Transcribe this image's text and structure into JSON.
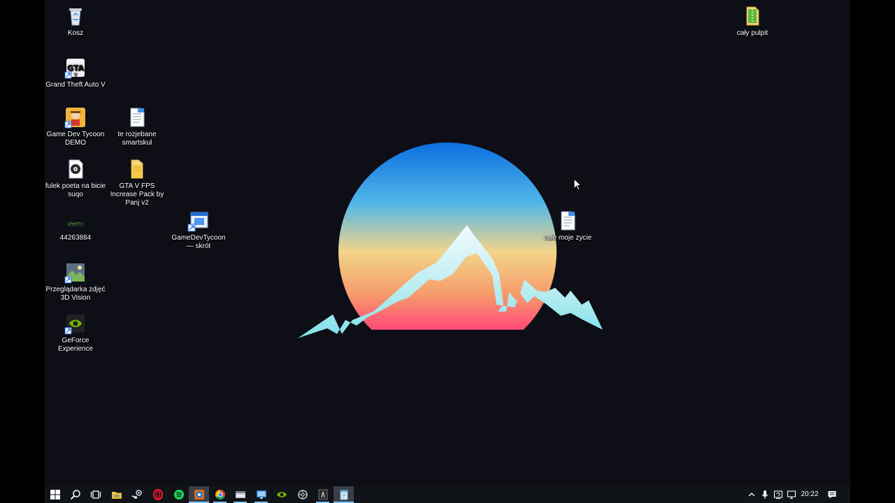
{
  "colors": {
    "desktop_background": "#0d0e16",
    "taskbar": "#101317",
    "sun_top": "#1a7ee6",
    "sun_bottom": "#ff1f7a",
    "mountain": "#c9f1f5"
  },
  "desktop_icons": [
    {
      "label": "Kosz",
      "icon": "recycle-bin-icon"
    },
    {
      "label": "Grand Theft Auto V",
      "icon": "gta-v-icon"
    },
    {
      "label": "Game Dev Tycoon DEMO",
      "icon": "game-dev-tycoon-icon"
    },
    {
      "label": "te rozjebane smartskul",
      "icon": "text-document-icon"
    },
    {
      "label": "fulek poeta na bicie suqo",
      "icon": "media-file-icon"
    },
    {
      "label": "GTA V FPS Increase Pack by Panj v2",
      "icon": "folder-icon"
    },
    {
      "label": "44263884",
      "icon": "image-file-icon"
    },
    {
      "label": "GameDevTycoon — skrót",
      "icon": "shortcut-icon"
    },
    {
      "label": "Przeglądarka zdjęć 3D Vision",
      "icon": "3d-vision-icon"
    },
    {
      "label": "GeForce Experience",
      "icon": "geforce-icon"
    },
    {
      "label": "całe moje zycie",
      "icon": "text-document-icon"
    },
    {
      "label": "cały pulpit",
      "icon": "archive-icon"
    }
  ],
  "taskbar": {
    "start": "windows-start-icon",
    "search": "search-icon",
    "task_view": "task-view-icon",
    "pinned": [
      "file-explorer-icon",
      "steam-icon",
      "opera-icon",
      "spotify-icon",
      "blue-app-icon",
      "chrome-icon",
      "app-window-icon",
      "monitor-app-icon",
      "nvidia-icon",
      "gear-app-icon",
      "dark-app-icon",
      "notepad-icon"
    ],
    "clock": "20:22"
  },
  "tray": [
    "chevron-up-icon",
    "microphone-icon",
    "update-icon",
    "network-icon",
    "notifications-icon"
  ]
}
